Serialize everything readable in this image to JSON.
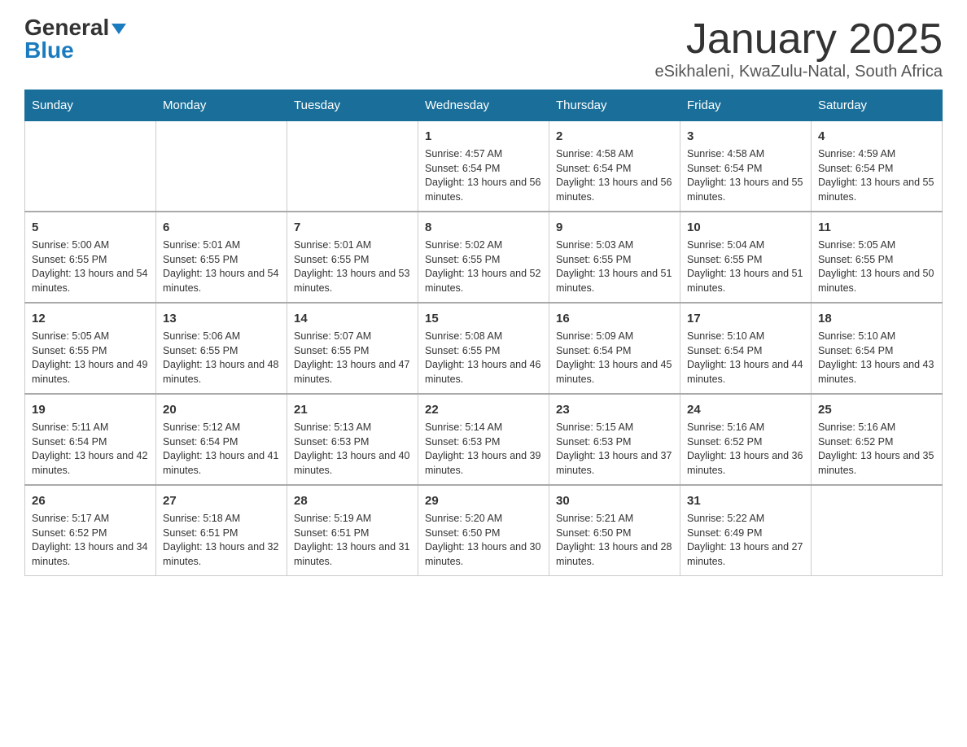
{
  "header": {
    "logo_general": "General",
    "logo_blue": "Blue",
    "month_title": "January 2025",
    "location": "eSikhaleni, KwaZulu-Natal, South Africa"
  },
  "weekdays": [
    "Sunday",
    "Monday",
    "Tuesday",
    "Wednesday",
    "Thursday",
    "Friday",
    "Saturday"
  ],
  "weeks": [
    [
      {
        "day": "",
        "info": ""
      },
      {
        "day": "",
        "info": ""
      },
      {
        "day": "",
        "info": ""
      },
      {
        "day": "1",
        "info": "Sunrise: 4:57 AM\nSunset: 6:54 PM\nDaylight: 13 hours and 56 minutes."
      },
      {
        "day": "2",
        "info": "Sunrise: 4:58 AM\nSunset: 6:54 PM\nDaylight: 13 hours and 56 minutes."
      },
      {
        "day": "3",
        "info": "Sunrise: 4:58 AM\nSunset: 6:54 PM\nDaylight: 13 hours and 55 minutes."
      },
      {
        "day": "4",
        "info": "Sunrise: 4:59 AM\nSunset: 6:54 PM\nDaylight: 13 hours and 55 minutes."
      }
    ],
    [
      {
        "day": "5",
        "info": "Sunrise: 5:00 AM\nSunset: 6:55 PM\nDaylight: 13 hours and 54 minutes."
      },
      {
        "day": "6",
        "info": "Sunrise: 5:01 AM\nSunset: 6:55 PM\nDaylight: 13 hours and 54 minutes."
      },
      {
        "day": "7",
        "info": "Sunrise: 5:01 AM\nSunset: 6:55 PM\nDaylight: 13 hours and 53 minutes."
      },
      {
        "day": "8",
        "info": "Sunrise: 5:02 AM\nSunset: 6:55 PM\nDaylight: 13 hours and 52 minutes."
      },
      {
        "day": "9",
        "info": "Sunrise: 5:03 AM\nSunset: 6:55 PM\nDaylight: 13 hours and 51 minutes."
      },
      {
        "day": "10",
        "info": "Sunrise: 5:04 AM\nSunset: 6:55 PM\nDaylight: 13 hours and 51 minutes."
      },
      {
        "day": "11",
        "info": "Sunrise: 5:05 AM\nSunset: 6:55 PM\nDaylight: 13 hours and 50 minutes."
      }
    ],
    [
      {
        "day": "12",
        "info": "Sunrise: 5:05 AM\nSunset: 6:55 PM\nDaylight: 13 hours and 49 minutes."
      },
      {
        "day": "13",
        "info": "Sunrise: 5:06 AM\nSunset: 6:55 PM\nDaylight: 13 hours and 48 minutes."
      },
      {
        "day": "14",
        "info": "Sunrise: 5:07 AM\nSunset: 6:55 PM\nDaylight: 13 hours and 47 minutes."
      },
      {
        "day": "15",
        "info": "Sunrise: 5:08 AM\nSunset: 6:55 PM\nDaylight: 13 hours and 46 minutes."
      },
      {
        "day": "16",
        "info": "Sunrise: 5:09 AM\nSunset: 6:54 PM\nDaylight: 13 hours and 45 minutes."
      },
      {
        "day": "17",
        "info": "Sunrise: 5:10 AM\nSunset: 6:54 PM\nDaylight: 13 hours and 44 minutes."
      },
      {
        "day": "18",
        "info": "Sunrise: 5:10 AM\nSunset: 6:54 PM\nDaylight: 13 hours and 43 minutes."
      }
    ],
    [
      {
        "day": "19",
        "info": "Sunrise: 5:11 AM\nSunset: 6:54 PM\nDaylight: 13 hours and 42 minutes."
      },
      {
        "day": "20",
        "info": "Sunrise: 5:12 AM\nSunset: 6:54 PM\nDaylight: 13 hours and 41 minutes."
      },
      {
        "day": "21",
        "info": "Sunrise: 5:13 AM\nSunset: 6:53 PM\nDaylight: 13 hours and 40 minutes."
      },
      {
        "day": "22",
        "info": "Sunrise: 5:14 AM\nSunset: 6:53 PM\nDaylight: 13 hours and 39 minutes."
      },
      {
        "day": "23",
        "info": "Sunrise: 5:15 AM\nSunset: 6:53 PM\nDaylight: 13 hours and 37 minutes."
      },
      {
        "day": "24",
        "info": "Sunrise: 5:16 AM\nSunset: 6:52 PM\nDaylight: 13 hours and 36 minutes."
      },
      {
        "day": "25",
        "info": "Sunrise: 5:16 AM\nSunset: 6:52 PM\nDaylight: 13 hours and 35 minutes."
      }
    ],
    [
      {
        "day": "26",
        "info": "Sunrise: 5:17 AM\nSunset: 6:52 PM\nDaylight: 13 hours and 34 minutes."
      },
      {
        "day": "27",
        "info": "Sunrise: 5:18 AM\nSunset: 6:51 PM\nDaylight: 13 hours and 32 minutes."
      },
      {
        "day": "28",
        "info": "Sunrise: 5:19 AM\nSunset: 6:51 PM\nDaylight: 13 hours and 31 minutes."
      },
      {
        "day": "29",
        "info": "Sunrise: 5:20 AM\nSunset: 6:50 PM\nDaylight: 13 hours and 30 minutes."
      },
      {
        "day": "30",
        "info": "Sunrise: 5:21 AM\nSunset: 6:50 PM\nDaylight: 13 hours and 28 minutes."
      },
      {
        "day": "31",
        "info": "Sunrise: 5:22 AM\nSunset: 6:49 PM\nDaylight: 13 hours and 27 minutes."
      },
      {
        "day": "",
        "info": ""
      }
    ]
  ]
}
